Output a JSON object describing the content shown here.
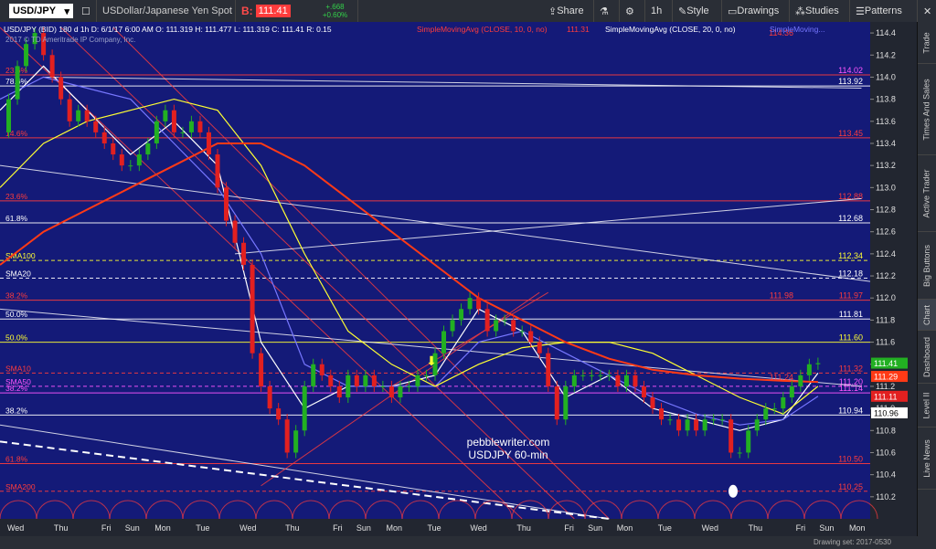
{
  "toolbar": {
    "symbol": "USD/JPY",
    "description": "USDollar/Japanese Yen Spot",
    "bid_label": "B:",
    "bid_value": "111.41",
    "change_abs": "+.668",
    "change_pct": "+0.60%",
    "buttons": [
      "Share",
      "1h",
      "Style",
      "Drawings",
      "Studies",
      "Patterns"
    ]
  },
  "info_line": "USD/JPY (BID) 180 d 1h    D: 6/1/17 6:00 AM  O: 111.319   H: 111.477   L: 111.319   C: 111.41   R: 0.15",
  "sma_study_1": "SimpleMovingAvg (CLOSE, 10, 0, no)",
  "sma_study_1_val": "111.31",
  "sma_study_2": "SimpleMovingAvg (CLOSE, 20, 0, no)",
  "sma_study_2_val": "SimpleMoving...",
  "copyright": "2017 © TD Ameritrade IP Company, Inc.",
  "watermark": [
    "pebblewriter.com",
    "USDJPY 60-min"
  ],
  "side_tabs": [
    "Trade",
    "Times And Sales",
    "Active Trader",
    "Big Buttons",
    "Chart",
    "Dashboard",
    "Level II",
    "Live News"
  ],
  "status": "Drawing set: 2017-0530",
  "colors": {
    "plot_bg": "#141a78",
    "up": "#22b022",
    "down": "#e22020",
    "fib_red": "#ff3c3c",
    "white": "#ffffff",
    "yellow": "#ffff33",
    "magenta": "#ff55ff",
    "ma_red": "#ff3a16",
    "ma_blue": "#7777ff"
  },
  "chart_data": {
    "type": "candlestick",
    "ylim": [
      110.0,
      114.5
    ],
    "y_ticks": [
      110.2,
      110.4,
      110.6,
      110.8,
      111,
      111.2,
      111.4,
      111.6,
      111.8,
      112,
      112.2,
      112.4,
      112.6,
      112.8,
      113,
      113.2,
      113.4,
      113.6,
      113.8,
      114,
      114.2,
      114.4
    ],
    "x_labels": [
      "Wed",
      "Thu",
      "Fri",
      "Sun",
      "Mon",
      "Tue",
      "Wed",
      "Thu",
      "Fri",
      "Sun",
      "Mon",
      "Tue",
      "Wed",
      "Thu",
      "Fri",
      "Sun",
      "Mon",
      "Tue",
      "Wed",
      "Thu",
      "Fri",
      "Sun",
      "Mon"
    ],
    "x_label_frac": [
      0.018,
      0.07,
      0.122,
      0.152,
      0.187,
      0.233,
      0.285,
      0.336,
      0.388,
      0.418,
      0.453,
      0.499,
      0.55,
      0.602,
      0.654,
      0.684,
      0.718,
      0.764,
      0.816,
      0.868,
      0.92,
      0.95,
      0.985
    ],
    "close_path": [
      [
        0,
        113.5
      ],
      [
        0.01,
        113.8
      ],
      [
        0.02,
        114.1
      ],
      [
        0.03,
        114.3
      ],
      [
        0.04,
        114.4
      ],
      [
        0.05,
        114.2
      ],
      [
        0.06,
        114.0
      ],
      [
        0.07,
        113.8
      ],
      [
        0.08,
        113.6
      ],
      [
        0.09,
        113.7
      ],
      [
        0.1,
        113.6
      ],
      [
        0.11,
        113.5
      ],
      [
        0.12,
        113.4
      ],
      [
        0.13,
        113.3
      ],
      [
        0.14,
        113.2
      ],
      [
        0.15,
        113.2
      ],
      [
        0.16,
        113.3
      ],
      [
        0.17,
        113.4
      ],
      [
        0.18,
        113.6
      ],
      [
        0.19,
        113.7
      ],
      [
        0.2,
        113.5
      ],
      [
        0.21,
        113.5
      ],
      [
        0.22,
        113.6
      ],
      [
        0.23,
        113.5
      ],
      [
        0.24,
        113.3
      ],
      [
        0.25,
        113.0
      ],
      [
        0.26,
        112.7
      ],
      [
        0.27,
        112.5
      ],
      [
        0.28,
        112.3
      ],
      [
        0.29,
        111.5
      ],
      [
        0.3,
        111.2
      ],
      [
        0.31,
        111.0
      ],
      [
        0.32,
        110.9
      ],
      [
        0.33,
        110.6
      ],
      [
        0.34,
        110.8
      ],
      [
        0.35,
        111.2
      ],
      [
        0.36,
        111.4
      ],
      [
        0.37,
        111.3
      ],
      [
        0.38,
        111.2
      ],
      [
        0.39,
        111.1
      ],
      [
        0.4,
        111.3
      ],
      [
        0.41,
        111.2
      ],
      [
        0.42,
        111.3
      ],
      [
        0.43,
        111.2
      ],
      [
        0.44,
        111.2
      ],
      [
        0.45,
        111.1
      ],
      [
        0.46,
        111.2
      ],
      [
        0.47,
        111.2
      ],
      [
        0.48,
        111.3
      ],
      [
        0.49,
        111.3
      ],
      [
        0.5,
        111.5
      ],
      [
        0.51,
        111.7
      ],
      [
        0.52,
        111.8
      ],
      [
        0.53,
        111.9
      ],
      [
        0.54,
        112.0
      ],
      [
        0.55,
        111.9
      ],
      [
        0.56,
        111.7
      ],
      [
        0.57,
        111.8
      ],
      [
        0.58,
        111.8
      ],
      [
        0.59,
        111.7
      ],
      [
        0.6,
        111.7
      ],
      [
        0.61,
        111.6
      ],
      [
        0.62,
        111.5
      ],
      [
        0.63,
        111.2
      ],
      [
        0.64,
        110.9
      ],
      [
        0.65,
        111.2
      ],
      [
        0.66,
        111.3
      ],
      [
        0.67,
        111.3
      ],
      [
        0.68,
        111.3
      ],
      [
        0.69,
        111.3
      ],
      [
        0.7,
        111.3
      ],
      [
        0.71,
        111.2
      ],
      [
        0.72,
        111.3
      ],
      [
        0.73,
        111.2
      ],
      [
        0.74,
        111.1
      ],
      [
        0.75,
        111.0
      ],
      [
        0.76,
        110.9
      ],
      [
        0.77,
        110.9
      ],
      [
        0.78,
        110.8
      ],
      [
        0.79,
        110.9
      ],
      [
        0.8,
        110.8
      ],
      [
        0.81,
        110.9
      ],
      [
        0.82,
        110.9
      ],
      [
        0.83,
        110.9
      ],
      [
        0.84,
        110.6
      ],
      [
        0.85,
        110.6
      ],
      [
        0.86,
        110.8
      ],
      [
        0.87,
        110.9
      ],
      [
        0.88,
        111.0
      ],
      [
        0.89,
        111.0
      ],
      [
        0.9,
        111.1
      ],
      [
        0.91,
        111.2
      ],
      [
        0.92,
        111.3
      ],
      [
        0.93,
        111.4
      ],
      [
        0.94,
        111.41
      ]
    ],
    "series": [
      {
        "name": "SMA10",
        "color": "#ffffff",
        "points": [
          [
            0,
            113.7
          ],
          [
            0.05,
            114.1
          ],
          [
            0.1,
            113.7
          ],
          [
            0.15,
            113.3
          ],
          [
            0.2,
            113.6
          ],
          [
            0.25,
            113.2
          ],
          [
            0.3,
            111.6
          ],
          [
            0.35,
            111.0
          ],
          [
            0.4,
            111.2
          ],
          [
            0.45,
            111.2
          ],
          [
            0.5,
            111.3
          ],
          [
            0.55,
            111.9
          ],
          [
            0.6,
            111.7
          ],
          [
            0.65,
            111.1
          ],
          [
            0.7,
            111.3
          ],
          [
            0.75,
            111.0
          ],
          [
            0.8,
            110.9
          ],
          [
            0.85,
            110.8
          ],
          [
            0.9,
            110.9
          ],
          [
            0.94,
            111.32
          ]
        ]
      },
      {
        "name": "SMA20",
        "color": "#7777ff",
        "points": [
          [
            0,
            113.8
          ],
          [
            0.05,
            114.0
          ],
          [
            0.1,
            113.9
          ],
          [
            0.15,
            113.8
          ],
          [
            0.2,
            113.4
          ],
          [
            0.25,
            113.0
          ],
          [
            0.3,
            112.4
          ],
          [
            0.35,
            111.4
          ],
          [
            0.4,
            111.2
          ],
          [
            0.45,
            111.2
          ],
          [
            0.5,
            111.2
          ],
          [
            0.55,
            111.6
          ],
          [
            0.6,
            111.7
          ],
          [
            0.65,
            111.5
          ],
          [
            0.7,
            111.3
          ],
          [
            0.75,
            111.1
          ],
          [
            0.8,
            110.95
          ],
          [
            0.85,
            110.85
          ],
          [
            0.9,
            110.9
          ],
          [
            0.94,
            111.11
          ]
        ]
      },
      {
        "name": "SMA50",
        "color": "#ffff33",
        "points": [
          [
            0,
            113.0
          ],
          [
            0.05,
            113.4
          ],
          [
            0.1,
            113.6
          ],
          [
            0.15,
            113.7
          ],
          [
            0.2,
            113.8
          ],
          [
            0.25,
            113.7
          ],
          [
            0.3,
            113.2
          ],
          [
            0.35,
            112.4
          ],
          [
            0.4,
            111.7
          ],
          [
            0.45,
            111.4
          ],
          [
            0.5,
            111.2
          ],
          [
            0.55,
            111.4
          ],
          [
            0.6,
            111.55
          ],
          [
            0.65,
            111.6
          ],
          [
            0.7,
            111.6
          ],
          [
            0.75,
            111.5
          ],
          [
            0.8,
            111.3
          ],
          [
            0.85,
            111.1
          ],
          [
            0.9,
            110.95
          ],
          [
            0.94,
            111.2
          ]
        ]
      },
      {
        "name": "SMA100",
        "color": "#ff3a16",
        "points": [
          [
            0,
            112.3
          ],
          [
            0.05,
            112.6
          ],
          [
            0.1,
            112.8
          ],
          [
            0.15,
            113.0
          ],
          [
            0.2,
            113.2
          ],
          [
            0.25,
            113.4
          ],
          [
            0.3,
            113.4
          ],
          [
            0.35,
            113.2
          ],
          [
            0.4,
            112.9
          ],
          [
            0.45,
            112.6
          ],
          [
            0.5,
            112.3
          ],
          [
            0.55,
            112.0
          ],
          [
            0.6,
            111.8
          ],
          [
            0.65,
            111.6
          ],
          [
            0.7,
            111.45
          ],
          [
            0.75,
            111.35
          ],
          [
            0.8,
            111.3
          ],
          [
            0.85,
            111.27
          ],
          [
            0.9,
            111.25
          ],
          [
            0.94,
            111.24
          ]
        ]
      }
    ],
    "hlines": [
      {
        "label": "23.6%",
        "value": 114.02,
        "color": "#ff3c3c",
        "tag": "114.02",
        "tagColor": "#ff55ff"
      },
      {
        "label": "78.6%",
        "value": 113.92,
        "color": "#ffffff",
        "tag": "113.92",
        "tagColor": "#ffffff"
      },
      {
        "label": "14.6%",
        "value": 113.45,
        "color": "#ff3c3c",
        "tag": "113.45",
        "tagColor": "#ff3c3c"
      },
      {
        "label": "23.6%",
        "value": 112.88,
        "color": "#ff3c3c",
        "tag": "112.88",
        "tagColor": "#ff3c3c"
      },
      {
        "label": "61.8%",
        "value": 112.68,
        "color": "#ffffff",
        "tag": "112.68",
        "tagColor": "#ffffff"
      },
      {
        "label": "SMA100",
        "value": 112.34,
        "color": "#ffff33",
        "tag": "112.34",
        "tagColor": "#ffff33",
        "dashed": true
      },
      {
        "label": "SMA20",
        "value": 112.18,
        "color": "#ffffff",
        "tag": "112.18",
        "tagColor": "#ffffff",
        "dashed": true
      },
      {
        "label": "38.2%",
        "value": 111.98,
        "color": "#ff3c3c",
        "tag": "111.97",
        "tagColor": "#ff3c3c",
        "tag2": "111.98"
      },
      {
        "label": "50.0%",
        "value": 111.81,
        "color": "#ffffff",
        "tag": "111.81",
        "tagColor": "#ffffff"
      },
      {
        "label": "50.0%",
        "value": 111.6,
        "color": "#ffff33",
        "tag": "111.60",
        "tagColor": "#ffff33"
      },
      {
        "label": "SMA10",
        "value": 111.32,
        "color": "#ff3c3c",
        "tag": "111.32",
        "tagColor": "#ff3c3c",
        "dashed": true
      },
      {
        "label": "SMA50",
        "value": 111.2,
        "color": "#ff55ff",
        "tag": "111.20",
        "tagColor": "#ff55ff",
        "dashed": true
      },
      {
        "label": "38.2%",
        "value": 111.14,
        "color": "#ff55ff",
        "tag": "111.14",
        "tagColor": "#ff55ff"
      },
      {
        "label": "38.2%",
        "value": 110.94,
        "color": "#ffffff",
        "tag": "110.94",
        "tagColor": "#ffffff"
      },
      {
        "label": "61.8%",
        "value": 110.5,
        "color": "#ff3c3c",
        "tag": "110.50",
        "tagColor": "#ff3c3c"
      },
      {
        "label": "SMA200",
        "value": 110.25,
        "color": "#ff3c3c",
        "tag": "110.25",
        "tagColor": "#ff3c3c",
        "dashed": true
      }
    ],
    "axis_tags": [
      {
        "value": 111.41,
        "text": "111.41",
        "bg": "#22b022",
        "fg": "#ffffff"
      },
      {
        "value": 111.29,
        "text": "111.29",
        "bg": "#ff3a16",
        "fg": "#ffffff"
      },
      {
        "value": 111.11,
        "text": "111.11",
        "bg": "#e22020",
        "fg": "#ffffff"
      },
      {
        "value": 110.96,
        "text": "110.96",
        "bg": "#ffffff",
        "fg": "#000000"
      }
    ],
    "extra_tags": [
      {
        "value": 111.24,
        "text": "111.24",
        "color": "#ff3c3c"
      },
      {
        "value": 114.36,
        "text": "114.36",
        "color": "#ff3c3c"
      }
    ]
  }
}
